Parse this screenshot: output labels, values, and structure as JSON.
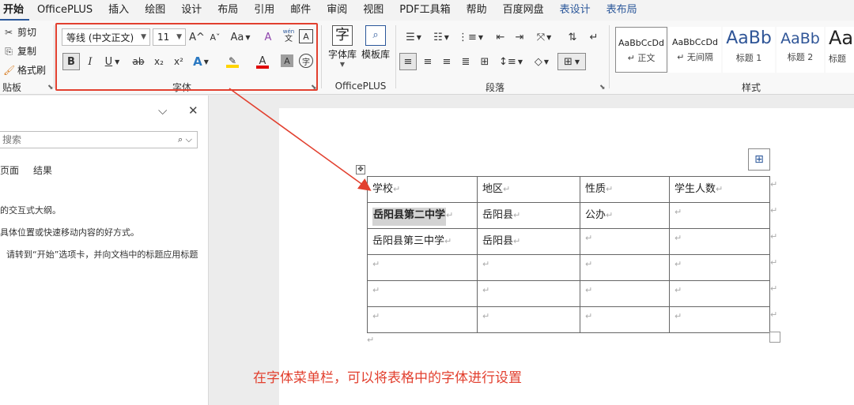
{
  "menu_tabs": [
    "开始",
    "OfficePLUS",
    "插入",
    "绘图",
    "设计",
    "布局",
    "引用",
    "邮件",
    "审阅",
    "视图",
    "PDF工具箱",
    "帮助",
    "百度网盘",
    "表设计",
    "表布局"
  ],
  "clipboard": {
    "cut": "剪切",
    "copy": "复制",
    "format_painter": "格式刷",
    "group_label": "贴板"
  },
  "font_group": {
    "font_name": "等线 (中文正文)",
    "font_size": "11",
    "grow": "A^",
    "shrink": "Aˇ",
    "change_case": "Aa",
    "clear": "A",
    "phonetic_top": "wén",
    "phonetic_bottom": "文",
    "border_char": "A",
    "bold": "B",
    "italic": "I",
    "underline": "U",
    "strike": "ab",
    "subscript": "x₂",
    "superscript": "x²",
    "text_effect": "A",
    "highlight": "✎",
    "font_color": "A",
    "char_shading": "A",
    "enclose": "字",
    "group_label": "字体"
  },
  "officeplus": {
    "font_lib": "字体库",
    "template_lib": "模板库",
    "font_lib_icon": "字",
    "group_label": "OfficePLUS"
  },
  "paragraph": {
    "group_label": "段落"
  },
  "styles": {
    "group_label": "样式",
    "items": [
      {
        "sample": "AaBbCcDd",
        "name": "↵ 正文"
      },
      {
        "sample": "AaBbCcDd",
        "name": "↵ 无间隔"
      },
      {
        "sample": "AaBb",
        "name": "标题 1"
      },
      {
        "sample": "AaBb",
        "name": "标题 2"
      },
      {
        "sample": "Aa",
        "name": "标题"
      }
    ]
  },
  "navpane": {
    "search_placeholder": "搜索",
    "tab_pages": "页面",
    "tab_results": "结果",
    "line1": "的交互式大纲。",
    "line2": "具体位置或快速移动内容的好方式。",
    "line3": "请转到“开始”选项卡，并向文档中的标题应用标题"
  },
  "table": {
    "headers": [
      "学校",
      "地区",
      "性质",
      "学生人数"
    ],
    "rows": [
      [
        "岳阳县第二中学",
        "岳阳县",
        "公办",
        ""
      ],
      [
        "岳阳县第三中学",
        "岳阳县",
        "",
        ""
      ],
      [
        "",
        "",
        "",
        ""
      ],
      [
        "",
        "",
        "",
        ""
      ],
      [
        "",
        "",
        "",
        ""
      ]
    ],
    "end_mark": "↵"
  },
  "annotation": "在字体菜单栏，可以将表格中的字体进行设置",
  "colors": {
    "accent": "#2b579a",
    "annotation": "#e2402f",
    "highlight": "#ffd400",
    "font_color": "#e00000"
  }
}
